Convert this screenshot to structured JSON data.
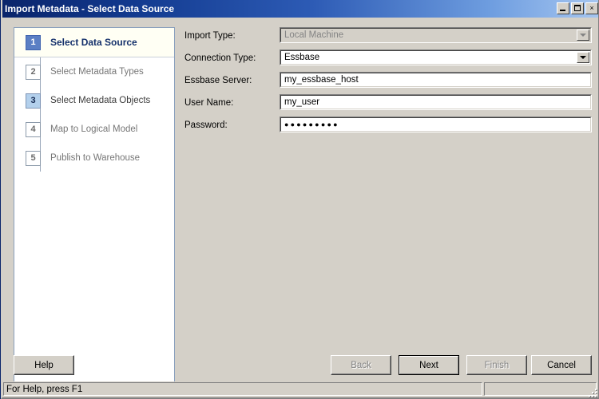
{
  "window": {
    "title": "Import Metadata - Select Data Source",
    "buttons": {
      "minimize": "minimize-icon",
      "maximize": "maximize-icon",
      "close": "×"
    },
    "accent_titlebar_dark": "#0a246a",
    "accent_titlebar_light": "#a6c6f0",
    "face_color": "#d4d0c8"
  },
  "sidebar": {
    "steps": [
      {
        "number": "1",
        "label": "Select Data Source",
        "state": "active"
      },
      {
        "number": "2",
        "label": "Select Metadata Types",
        "state": "pending"
      },
      {
        "number": "3",
        "label": "Select Metadata Objects",
        "state": "visited"
      },
      {
        "number": "4",
        "label": "Map to Logical Model",
        "state": "pending"
      },
      {
        "number": "5",
        "label": "Publish to Warehouse",
        "state": "pending"
      }
    ],
    "active_bg": "#fffff4",
    "active_num_bg": "#5b7fc4",
    "visited_num_bg": "#b3d0ec"
  },
  "form": {
    "rows": [
      {
        "label": "Import Type:",
        "control": "combobox",
        "value": "Local Machine",
        "placeholder": "",
        "disabled": true,
        "icon": "chevron-down-icon"
      },
      {
        "label": "Connection Type:",
        "control": "combobox",
        "value": "Essbase",
        "placeholder": "",
        "disabled": false,
        "icon": "chevron-down-icon"
      },
      {
        "label": "Essbase Server:",
        "control": "textbox",
        "value": "my_essbase_host",
        "placeholder": "",
        "disabled": false
      },
      {
        "label": "User Name:",
        "control": "textbox",
        "value": "my_user",
        "placeholder": "",
        "disabled": false
      },
      {
        "label": "Password:",
        "control": "password",
        "value": "●●●●●●●●●",
        "placeholder": "",
        "disabled": false
      }
    ]
  },
  "footer": {
    "help_label": "Help",
    "back_label": "Back",
    "next_label": "Next",
    "finish_label": "Finish",
    "cancel_label": "Cancel",
    "back_disabled": true,
    "finish_disabled": true,
    "next_is_default": true
  },
  "statusbar": {
    "message": "For Help, press F1",
    "grip": "resize-grip-icon"
  }
}
